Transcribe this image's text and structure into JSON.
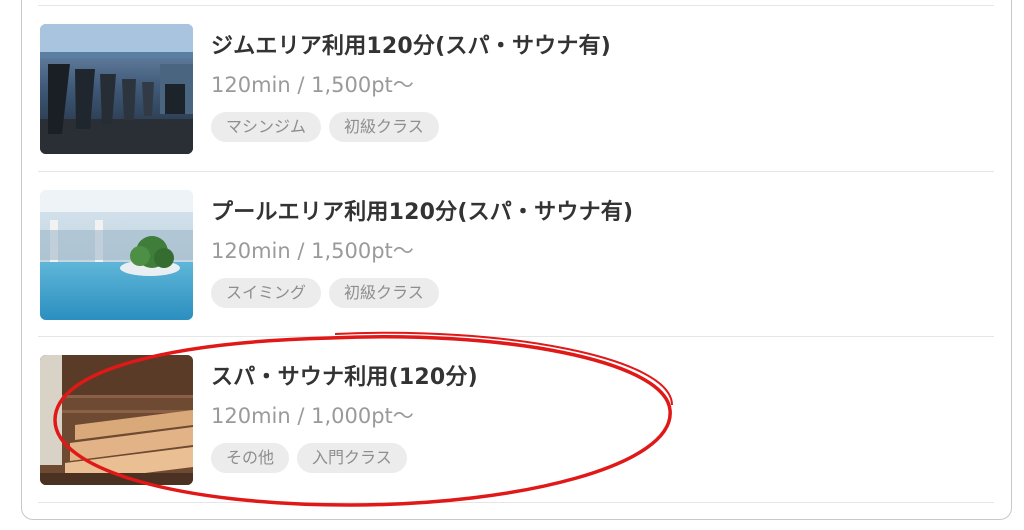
{
  "items": [
    {
      "title": "ジムエリア利用120分(スパ・サウナ有)",
      "meta": "120min / 1,500pt～",
      "tags": [
        "マシンジム",
        "初級クラス"
      ],
      "image": "gym-machines-photo"
    },
    {
      "title": "プールエリア利用120分(スパ・サウナ有)",
      "meta": "120min / 1,500pt～",
      "tags": [
        "スイミング",
        "初級クラス"
      ],
      "image": "indoor-pool-photo"
    },
    {
      "title": "スパ・サウナ利用(120分)",
      "meta": "120min / 1,000pt～",
      "tags": [
        "その他",
        "入門クラス"
      ],
      "image": "sauna-room-photo"
    }
  ],
  "colors": {
    "title": "#333333",
    "meta": "#9a9a9a",
    "tag_bg": "#ececec",
    "annotation": "#e01818"
  }
}
